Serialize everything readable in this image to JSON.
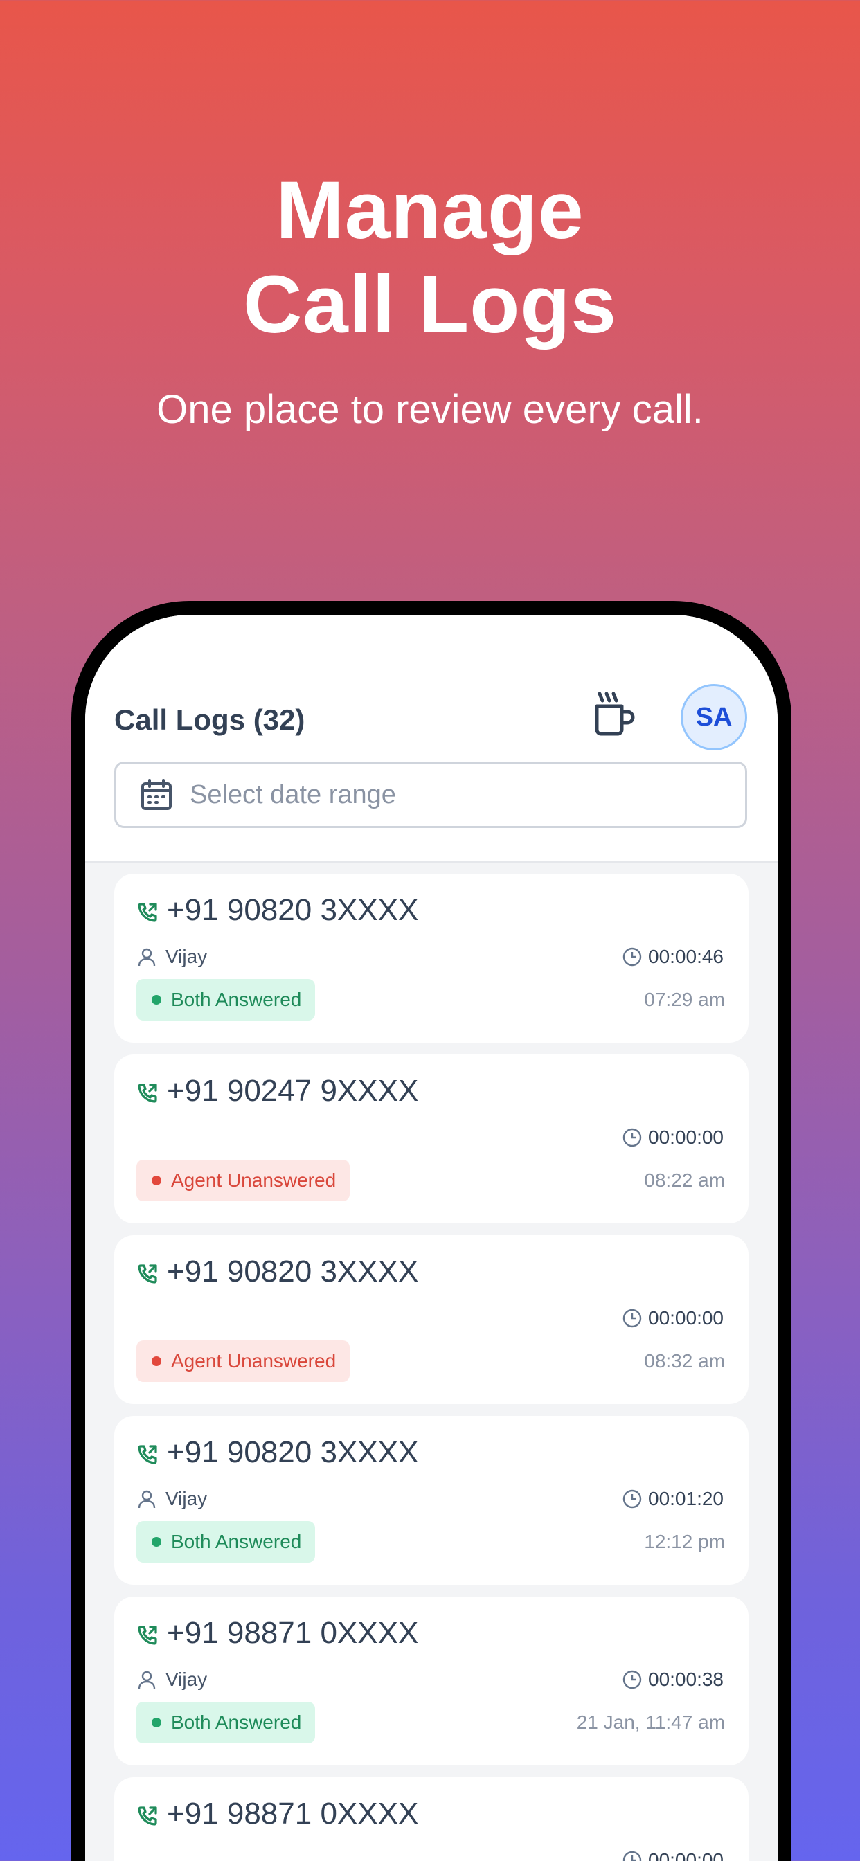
{
  "hero": {
    "title_line1": "Manage",
    "title_line2": "Call Logs",
    "subtitle": "One place to review every call."
  },
  "header": {
    "title": "Call Logs (32)",
    "break_icon": "coffee-cup-icon",
    "avatar_initials": "SA",
    "date_placeholder": "Select date range",
    "calendar_icon": "calendar-icon"
  },
  "colors": {
    "gradient_top": "#e8564a",
    "gradient_bottom": "#6565ee",
    "answered_bg": "#d9f7ea",
    "answered_text": "#1f8b5a",
    "unanswered_bg": "#fde7e5",
    "unanswered_text": "#d9473b"
  },
  "calls": [
    {
      "number": "+91 90820 3XXXX",
      "agent": "Vijay",
      "duration": "00:00:46",
      "status": "Both Answered",
      "time": "07:29 am"
    },
    {
      "number": "+91 90247 9XXXX",
      "agent": "",
      "duration": "00:00:00",
      "status": "Agent Unanswered",
      "time": "08:22 am"
    },
    {
      "number": "+91 90820 3XXXX",
      "agent": "",
      "duration": "00:00:00",
      "status": "Agent Unanswered",
      "time": "08:32 am"
    },
    {
      "number": "+91 90820 3XXXX",
      "agent": "Vijay",
      "duration": "00:01:20",
      "status": "Both Answered",
      "time": "12:12 pm"
    },
    {
      "number": "+91 98871 0XXXX",
      "agent": "Vijay",
      "duration": "00:00:38",
      "status": "Both Answered",
      "time": "21 Jan, 11:47 am"
    },
    {
      "number": "+91 98871 0XXXX",
      "agent": "",
      "duration": "00:00:00",
      "status": "",
      "time": ""
    }
  ]
}
